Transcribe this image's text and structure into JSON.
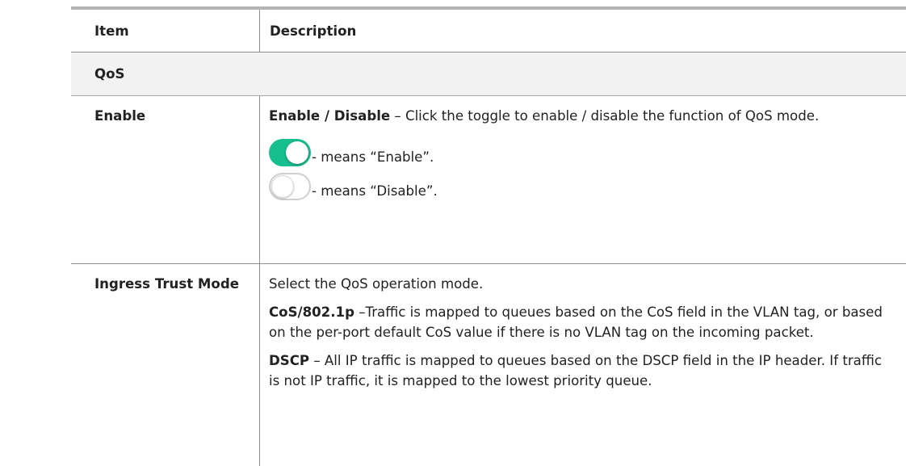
{
  "table": {
    "header": {
      "item": "Item",
      "description": "Description"
    },
    "section": "QoS",
    "rows": [
      {
        "item": "Enable",
        "intro_bold": "Enable / Disable",
        "intro_text": " – Click the toggle to enable / disable the function of QoS mode.",
        "toggle_on_text": "- means “Enable”.",
        "toggle_off_text": "- means “Disable”."
      },
      {
        "item": "Ingress Trust Mode",
        "intro_text": "Select the QoS operation mode.",
        "p1_bold": "CoS/802.1p",
        "p1_text": " –Traffic is mapped to queues based on the CoS field in the VLAN tag, or based on the per-port default CoS value if there is no VLAN tag on the incoming packet.",
        "p2_bold": "DSCP",
        "p2_text": " – All IP traffic is mapped to queues based on the DSCP field in the IP header. If traffic is not IP traffic, it is mapped to the lowest priority queue."
      }
    ]
  },
  "colors": {
    "toggle_on": "#18bf8e",
    "toggle_off_border": "#cfcfcf",
    "rule": "#b4b4b4",
    "section_bg": "#f2f2f2"
  }
}
